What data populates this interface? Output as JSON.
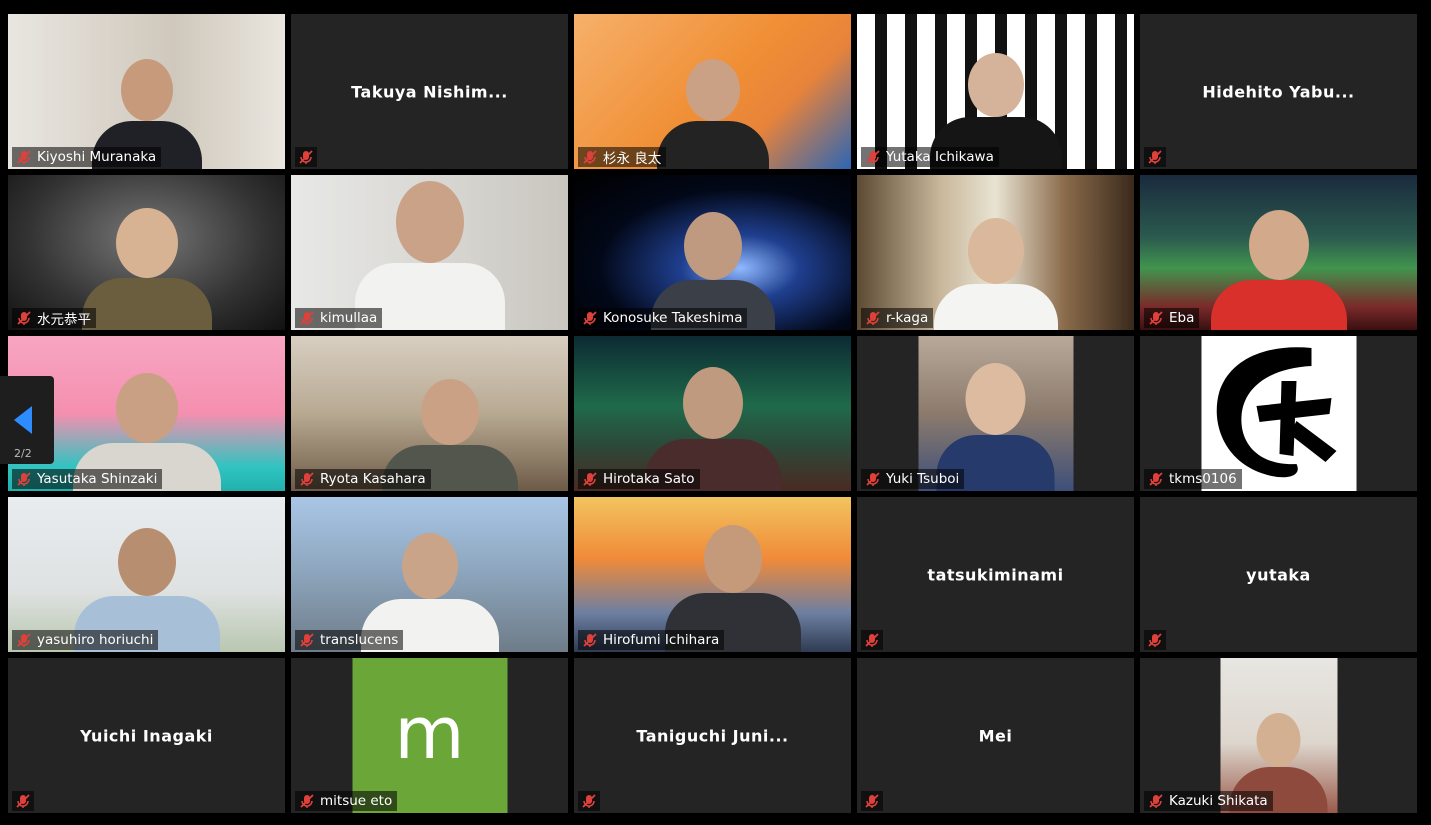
{
  "pager": {
    "page_label": "2/2"
  },
  "participants": [
    {
      "name": "Kiyoshi Muranaka",
      "video": true
    },
    {
      "name": "Takuya Nishim...",
      "video": false
    },
    {
      "name": "杉永 良太",
      "video": true
    },
    {
      "name": "Yutaka Ichikawa",
      "video": true
    },
    {
      "name": "Hidehito Yabu...",
      "video": false
    },
    {
      "name": "水元恭平",
      "video": true
    },
    {
      "name": "kimullaa",
      "video": true
    },
    {
      "name": "Konosuke Takeshima",
      "video": true
    },
    {
      "name": "r-kaga",
      "video": true
    },
    {
      "name": "Eba",
      "video": true
    },
    {
      "name": "Yasutaka Shinzaki",
      "video": true
    },
    {
      "name": "Ryota Kasahara",
      "video": true
    },
    {
      "name": "Hirotaka Sato",
      "video": true
    },
    {
      "name": "Yuki Tsuboi",
      "video": true
    },
    {
      "name": "tkms0106",
      "video": true
    },
    {
      "name": "yasuhiro horiuchi",
      "video": true
    },
    {
      "name": "translucens",
      "video": true
    },
    {
      "name": "Hirofumi Ichihara",
      "video": true
    },
    {
      "name": "tatsukiminami",
      "video": false
    },
    {
      "name": "yutaka",
      "video": false
    },
    {
      "name": "Yuichi Inagaki",
      "video": false
    },
    {
      "name": "mitsue eto",
      "video": true,
      "avatar_letter": "m"
    },
    {
      "name": "Taniguchi Juni...",
      "video": false
    },
    {
      "name": "Mei",
      "video": false
    },
    {
      "name": "Kazuki Shikata",
      "video": true
    }
  ],
  "colors": {
    "tile_bg": "#242424",
    "muted_icon": "#e0403a",
    "pager_arrow": "#2d8cff",
    "avatar_green": "#6aa638"
  }
}
